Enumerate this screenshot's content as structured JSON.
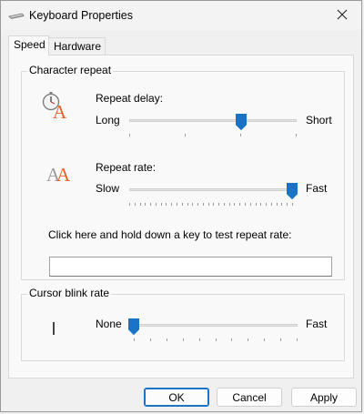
{
  "window": {
    "title": "Keyboard Properties"
  },
  "tabs": [
    {
      "label": "Speed",
      "active": true
    },
    {
      "label": "Hardware",
      "active": false
    }
  ],
  "character_repeat": {
    "label": "Character repeat",
    "repeat_delay": {
      "label": "Repeat delay:",
      "min_label": "Long",
      "max_label": "Short",
      "ticks": 4,
      "value_fraction": 0.67
    },
    "repeat_rate": {
      "label": "Repeat rate:",
      "min_label": "Slow",
      "max_label": "Fast",
      "ticks": 32,
      "value_fraction": 1.0
    },
    "test": {
      "label": "Click here and hold down a key to test repeat rate:",
      "value": ""
    }
  },
  "cursor_blink": {
    "label": "Cursor blink rate",
    "min_label": "None",
    "max_label": "Fast",
    "ticks": 11,
    "value_fraction": 0.0
  },
  "buttons": {
    "ok": "OK",
    "cancel": "Cancel",
    "apply": "Apply"
  },
  "colors": {
    "accent": "#1a73c7",
    "icon_orange": "#e8632a",
    "icon_gray": "#9a9a9a"
  },
  "icons": {
    "app": "keyboard-icon",
    "close": "close-icon",
    "delay": "stopwatch-letter-icon",
    "rate": "double-letter-icon",
    "blink": "text-cursor-icon"
  }
}
